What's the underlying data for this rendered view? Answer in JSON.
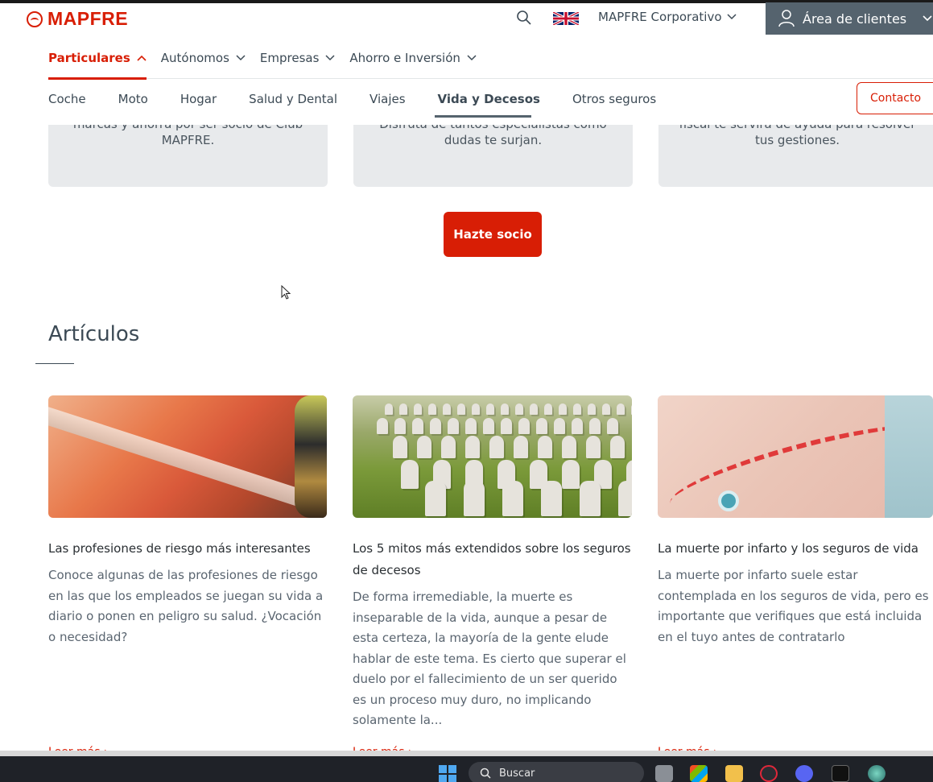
{
  "header": {
    "logo": "MAPFRE",
    "corporate_label": "MAPFRE Corporativo",
    "clients_label": "Área de clientes"
  },
  "nav_primary": [
    {
      "label": "Particulares",
      "active": true
    },
    {
      "label": "Autónomos",
      "active": false
    },
    {
      "label": "Empresas",
      "active": false
    },
    {
      "label": "Ahorro e Inversión",
      "active": false
    }
  ],
  "nav_secondary": [
    {
      "label": "Coche",
      "active": false
    },
    {
      "label": "Moto",
      "active": false
    },
    {
      "label": "Hogar",
      "active": false
    },
    {
      "label": "Salud y Dental",
      "active": false
    },
    {
      "label": "Viajes",
      "active": false
    },
    {
      "label": "Vida y Decesos",
      "active": true
    },
    {
      "label": "Otros seguros",
      "active": false
    }
  ],
  "contact_label": "Contacto",
  "benefit_cards": [
    {
      "cut_line": "marcas y ahorra por ser socio de Club",
      "text": "MAPFRE."
    },
    {
      "cut_line": "Disfruta de tantos especialistas como",
      "text": "dudas te surjan."
    },
    {
      "cut_line": "fiscal te servirá de ayuda para resolver",
      "text": "tus gestiones."
    }
  ],
  "cta_label": "Hazte socio",
  "articles_heading": "Artículos",
  "articles": [
    {
      "title": "Las profesiones de riesgo más interesantes",
      "description": "Conoce algunas de las profesiones de riesgo en las que los empleados se juegan su vida a diario o ponen en peligro su salud. ¿Vocación o necesidad?",
      "link": "Leer más"
    },
    {
      "title": "Los 5 mitos más extendidos sobre los seguros de decesos",
      "description": "De forma irremediable, la muerte es inseparable de la vida, aunque a pesar de esta certeza, la mayoría de la gente elude hablar de este tema. Es cierto que superar el duelo por el fallecimiento de un ser querido es un proceso muy duro, no implicando solamente la...",
      "link": "Leer más"
    },
    {
      "title": "La muerte por infarto y los seguros de vida",
      "description": "La muerte por infarto suele estar contemplada en los seguros de vida, pero es importante que verifiques que está incluida en el tuyo antes de contratarlo",
      "link": "Leer más"
    }
  ],
  "taskbar": {
    "search_label": "Buscar"
  },
  "colors": {
    "brand_red": "#d81e05",
    "clients_bg": "#55636e",
    "card_bg": "#e8eaec"
  }
}
